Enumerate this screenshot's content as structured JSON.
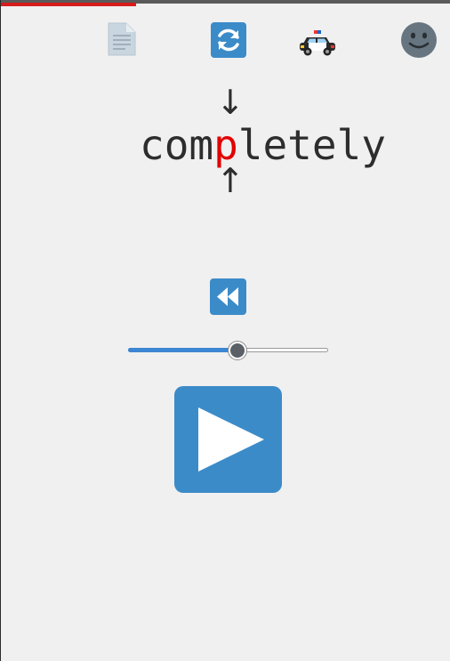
{
  "progress": {
    "fraction": 0.3
  },
  "toolbar": {
    "icons": [
      "document-icon",
      "refresh-icon",
      "police-car-icon",
      "smiley-face-icon"
    ]
  },
  "reader": {
    "word_before": "com",
    "word_focus": "p",
    "word_after": "letely",
    "arrow_down": "↓",
    "arrow_up": "↑",
    "focus_color": "#e30000"
  },
  "controls": {
    "speed_slider": {
      "fraction": 0.545
    },
    "accent_color": "#3c8bc9"
  }
}
